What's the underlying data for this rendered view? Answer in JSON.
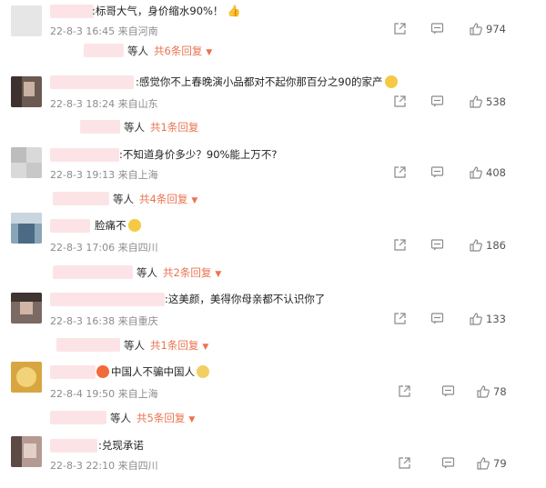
{
  "comments": [
    {
      "text": ":标哥大气，身价缩水90%！",
      "meta": "22-8-3 16:45 来自河南",
      "likes": "974",
      "reply": {
        "dengren": "等人",
        "more": "共6条回复"
      }
    },
    {
      "text": ":感觉你不上春晚演小品都对不起你那百分之90的家产",
      "meta": "22-8-3 18:24 来自山东",
      "likes": "538",
      "reply": {
        "dengren": "等人",
        "more": "共1条回复"
      }
    },
    {
      "text": ":不知道身价多少？90%能上万不?",
      "meta": "22-8-3 19:13 来自上海",
      "likes": "408",
      "reply": {
        "dengren": "等人",
        "more": "共4条回复"
      }
    },
    {
      "text": "脸痛不",
      "meta": "22-8-3 17:06 来自四川",
      "likes": "186",
      "reply": {
        "dengren": "等人",
        "more": "共2条回复"
      }
    },
    {
      "text": ":这美颜，美得你母亲都不认识你了",
      "meta": "22-8-3 16:38 来自重庆",
      "likes": "133",
      "reply": {
        "dengren": "等人",
        "more": "共1条回复"
      }
    },
    {
      "text": "中国人不骗中国人",
      "meta": "22-8-4 19:50 来自上海",
      "likes": "78",
      "reply": {
        "dengren": "等人",
        "more": "共5条回复"
      }
    },
    {
      "text": ":兑现承诺",
      "meta": "22-8-3 22:10 来自四川",
      "likes": "79",
      "reply": null
    }
  ],
  "icons": {
    "share": "share-icon",
    "comment": "comment-icon",
    "like": "thumbs-up-icon",
    "caret": "▼"
  },
  "colors": {
    "accent": "#eb7350",
    "blur": "#fce4e6",
    "meta": "#8c8c8c"
  }
}
